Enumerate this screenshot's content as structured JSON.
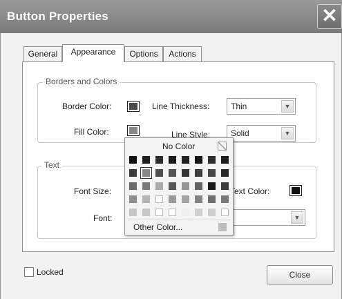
{
  "window": {
    "title": "Button Properties",
    "close_icon": "close-icon"
  },
  "tabs": [
    {
      "label": "General",
      "active": false
    },
    {
      "label": "Appearance",
      "active": true
    },
    {
      "label": "Options",
      "active": false
    },
    {
      "label": "Actions",
      "active": false
    }
  ],
  "borders_colors": {
    "legend": "Borders and Colors",
    "border_color_label": "Border Color:",
    "border_color": "#4a4a4a",
    "line_thickness_label": "Line Thickness:",
    "line_thickness": "Thin",
    "fill_color_label": "Fill Color:",
    "fill_color": "#888888",
    "line_style_label": "Line Style:",
    "line_style": "Solid"
  },
  "text_group": {
    "legend": "Text",
    "font_size_label": "Font Size:",
    "text_color_label": "Text Color:",
    "text_color": "#111111",
    "font_label": "Font:",
    "font_value": ""
  },
  "color_popup": {
    "no_color_label": "No Color",
    "other_color_label": "Other Color...",
    "swatches": [
      [
        "#111111",
        "#1e1e1e",
        "#2a2a2a",
        "#1a1a1a",
        "#222222",
        "#161616",
        "#2e2e2e",
        "#1c1c1c"
      ],
      [
        "#3a3a3a",
        "#888888",
        "#4e4e4e",
        "#555555",
        "#333333",
        "#3f3f3f",
        "#474747",
        "#262626"
      ],
      [
        "#6a6a6a",
        "#7a7a7a",
        "#aaaaaa",
        "#5a5a5a",
        "#959595",
        "#626262",
        "#1a1a1a",
        "#3e3e3e"
      ],
      [
        "#8e8e8e",
        "#b4b4b4",
        "#ffffff",
        "#9a9a9a",
        "#a4a4a4",
        "#858585",
        "#6e6e6e",
        "#7a7a7a"
      ],
      [
        "#c8c8c8",
        "#c6c6c6",
        "#ffffff",
        "#ffffff",
        "#eeeeee",
        "#d0d0d0",
        "#cecece",
        "#ffffff"
      ]
    ],
    "selected": "1,1"
  },
  "locked_label": "Locked",
  "close_button_label": "Close"
}
